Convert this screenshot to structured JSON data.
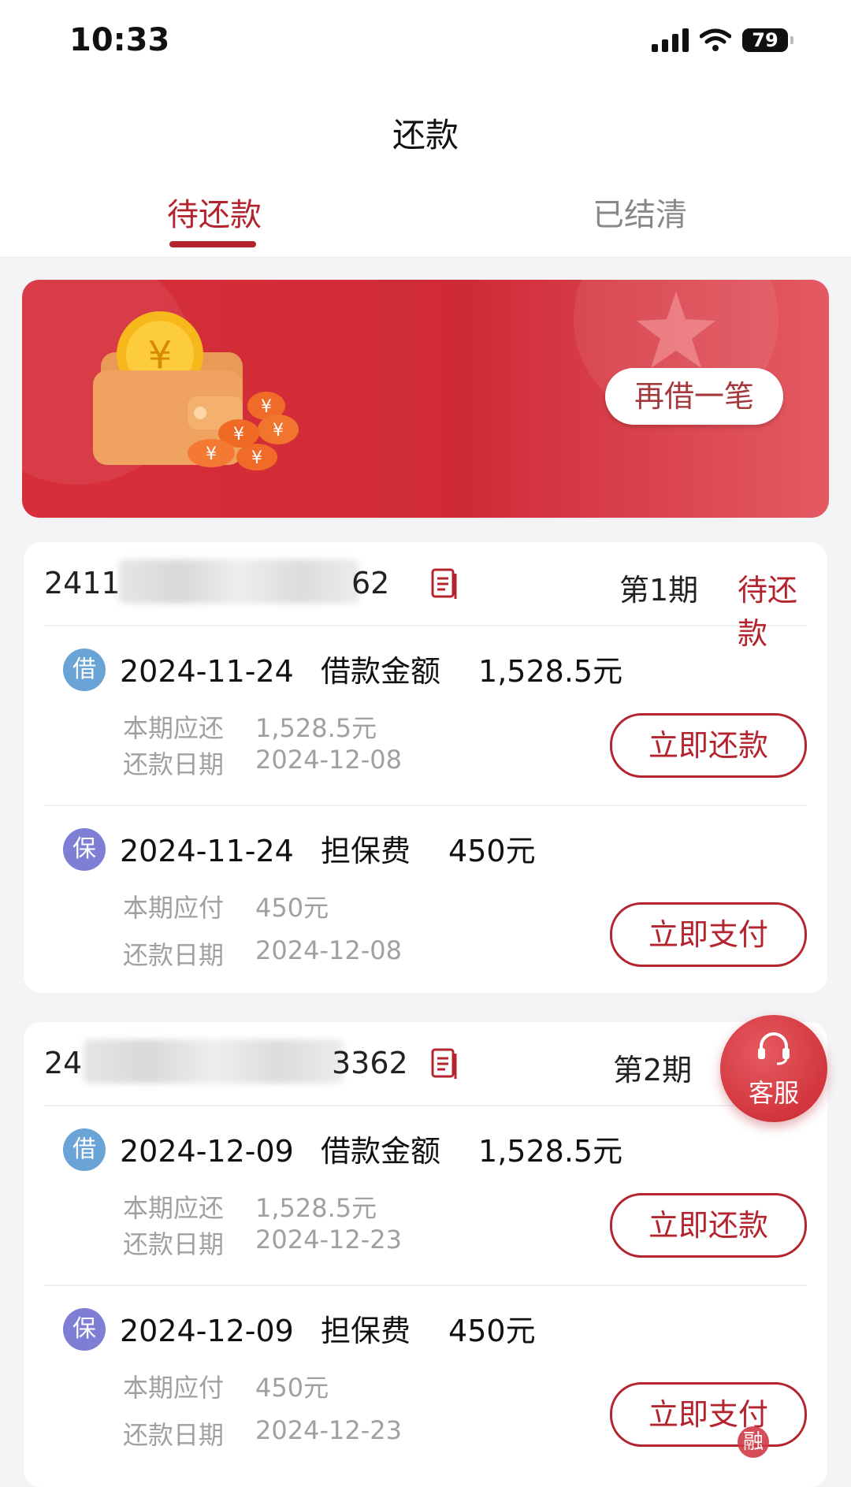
{
  "status_bar": {
    "time": "10:33",
    "battery": "79"
  },
  "page_title": "还款",
  "tabs": [
    {
      "label": "待还款",
      "active": true
    },
    {
      "label": "已结清",
      "active": false
    }
  ],
  "banner": {
    "button_label": "再借一笔"
  },
  "cards": [
    {
      "order_prefix": "2411",
      "order_suffix": "62",
      "period": "第1期",
      "status": "待还款",
      "rows": [
        {
          "badge": "借",
          "date": "2024-11-24",
          "kind": "借款金额",
          "amount": "1,528.5元",
          "line1_label": "本期应还",
          "line1_value": "1,528.5元",
          "line2_label": "还款日期",
          "line2_value": "2024-12-08",
          "button": "立即还款"
        },
        {
          "badge": "保",
          "date": "2024-11-24",
          "kind": "担保费",
          "amount": "450元",
          "line1_label": "本期应付",
          "line1_value": "450元",
          "line2_label": "还款日期",
          "line2_value": "2024-12-08",
          "button": "立即支付"
        }
      ]
    },
    {
      "order_prefix": "24",
      "order_suffix": "3362",
      "period": "第2期",
      "status": "",
      "rows": [
        {
          "badge": "借",
          "date": "2024-12-09",
          "kind": "借款金额",
          "amount": "1,528.5元",
          "line1_label": "本期应还",
          "line1_value": "1,528.5元",
          "line2_label": "还款日期",
          "line2_value": "2024-12-23",
          "button": "立即还款"
        },
        {
          "badge": "保",
          "date": "2024-12-09",
          "kind": "担保费",
          "amount": "450元",
          "line1_label": "本期应付",
          "line1_value": "450元",
          "line2_label": "还款日期",
          "line2_value": "2024-12-23",
          "button": "立即支付"
        }
      ]
    }
  ],
  "customer_service": {
    "label": "客服"
  },
  "watermark": "融"
}
